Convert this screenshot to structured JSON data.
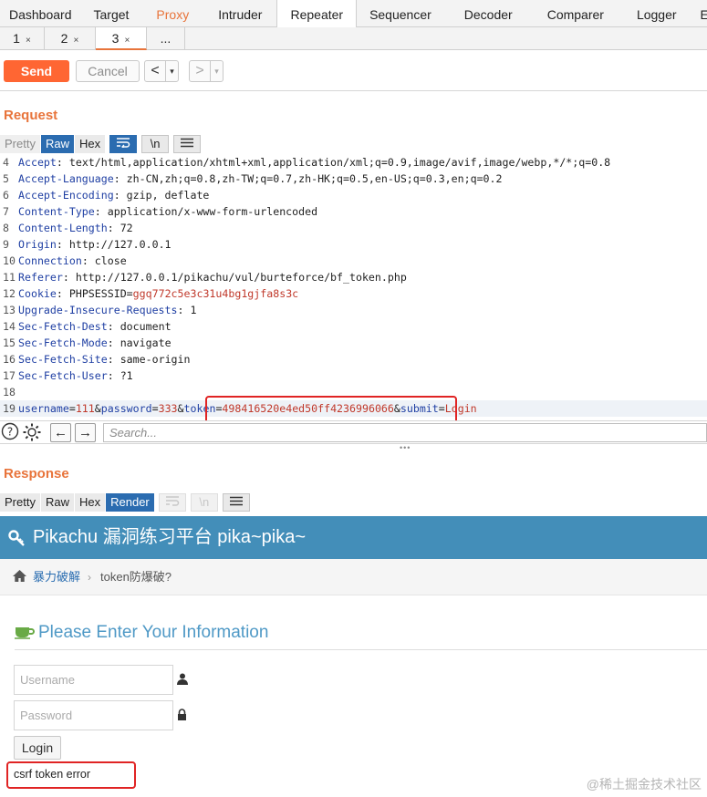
{
  "top_tabs": [
    "Dashboard",
    "Target",
    "Proxy",
    "Intruder",
    "Repeater",
    "Sequencer",
    "Decoder",
    "Comparer",
    "Logger",
    "Ex"
  ],
  "sub_tabs": [
    {
      "label": "1",
      "close": "×"
    },
    {
      "label": "2",
      "close": "×"
    },
    {
      "label": "3",
      "close": "×"
    },
    {
      "label": "...",
      "close": ""
    }
  ],
  "toolbar": {
    "send": "Send",
    "cancel": "Cancel",
    "back": "<",
    "forward": ">",
    "drop": "▾"
  },
  "request": {
    "title": "Request",
    "views": [
      "Pretty",
      "Raw",
      "Hex"
    ],
    "view_icons": [
      "wrap-icon",
      "newline-icon",
      "menu-icon"
    ],
    "newline_glyph": "\\n",
    "lines": [
      {
        "n": "4",
        "key": "Accept",
        "value": "text/html,application/xhtml+xml,application/xml;q=0.9,image/avif,image/webp,*/*;q=0.8"
      },
      {
        "n": "5",
        "key": "Accept-Language",
        "value": "zh-CN,zh;q=0.8,zh-TW;q=0.7,zh-HK;q=0.5,en-US;q=0.3,en;q=0.2"
      },
      {
        "n": "6",
        "key": "Accept-Encoding",
        "value": "gzip, deflate"
      },
      {
        "n": "7",
        "key": "Content-Type",
        "value": "application/x-www-form-urlencoded"
      },
      {
        "n": "8",
        "key": "Content-Length",
        "value": "72"
      },
      {
        "n": "9",
        "key": "Origin",
        "value": "http://127.0.0.1"
      },
      {
        "n": "10",
        "key": "Connection",
        "value": "close"
      },
      {
        "n": "11",
        "key": "Referer",
        "value": "http://127.0.0.1/pikachu/vul/burteforce/bf_token.php"
      },
      {
        "n": "12",
        "key": "Cookie",
        "value": "PHPSESSID=",
        "value_red": "ggq772c5e3c31u4bg1gjfa8s3c"
      },
      {
        "n": "13",
        "key": "Upgrade-Insecure-Requests",
        "value": "1"
      },
      {
        "n": "14",
        "key": "Sec-Fetch-Dest",
        "value": "document"
      },
      {
        "n": "15",
        "key": "Sec-Fetch-Mode",
        "value": "navigate"
      },
      {
        "n": "16",
        "key": "Sec-Fetch-Site",
        "value": "same-origin"
      },
      {
        "n": "17",
        "key": "Sec-Fetch-User",
        "value": "?1"
      },
      {
        "n": "18",
        "key": "",
        "value": ""
      }
    ],
    "body_line": {
      "n": "19",
      "parts": [
        {
          "t": "username",
          "c": "hk"
        },
        {
          "t": "=",
          "c": "hv"
        },
        {
          "t": "111",
          "c": "red"
        },
        {
          "t": "&",
          "c": "hv"
        },
        {
          "t": "password",
          "c": "hk"
        },
        {
          "t": "=",
          "c": "hv"
        },
        {
          "t": "333",
          "c": "red"
        },
        {
          "t": "&",
          "c": "hv"
        },
        {
          "t": "token",
          "c": "hk"
        },
        {
          "t": "=",
          "c": "hv"
        },
        {
          "t": "498416520e4ed50ff4236996066",
          "c": "red"
        },
        {
          "t": "&",
          "c": "hv"
        },
        {
          "t": "submit",
          "c": "hk"
        },
        {
          "t": "=",
          "c": "hv"
        },
        {
          "t": "Login",
          "c": "red"
        }
      ]
    },
    "search_placeholder": "Search..."
  },
  "response": {
    "title": "Response",
    "views": [
      "Pretty",
      "Raw",
      "Hex",
      "Render"
    ],
    "newline_glyph": "\\n"
  },
  "rendered_page": {
    "header": "Pikachu 漏洞练习平台 pika~pika~",
    "breadcrumb_1": "暴力破解",
    "breadcrumb_sep": "›",
    "breadcrumb_2": "token防爆破?",
    "form_title": "Please Enter Your Information",
    "username_placeholder": "Username",
    "password_placeholder": "Password",
    "login_button": "Login",
    "error_text": "csrf token error",
    "watermark": "@稀土掘金技术社区"
  },
  "colors": {
    "accent": "#e8743b",
    "send": "#ff6633",
    "active_view": "#2b6cb0",
    "pikachu_header": "#438eb9",
    "highlight_box": "#e02424"
  }
}
